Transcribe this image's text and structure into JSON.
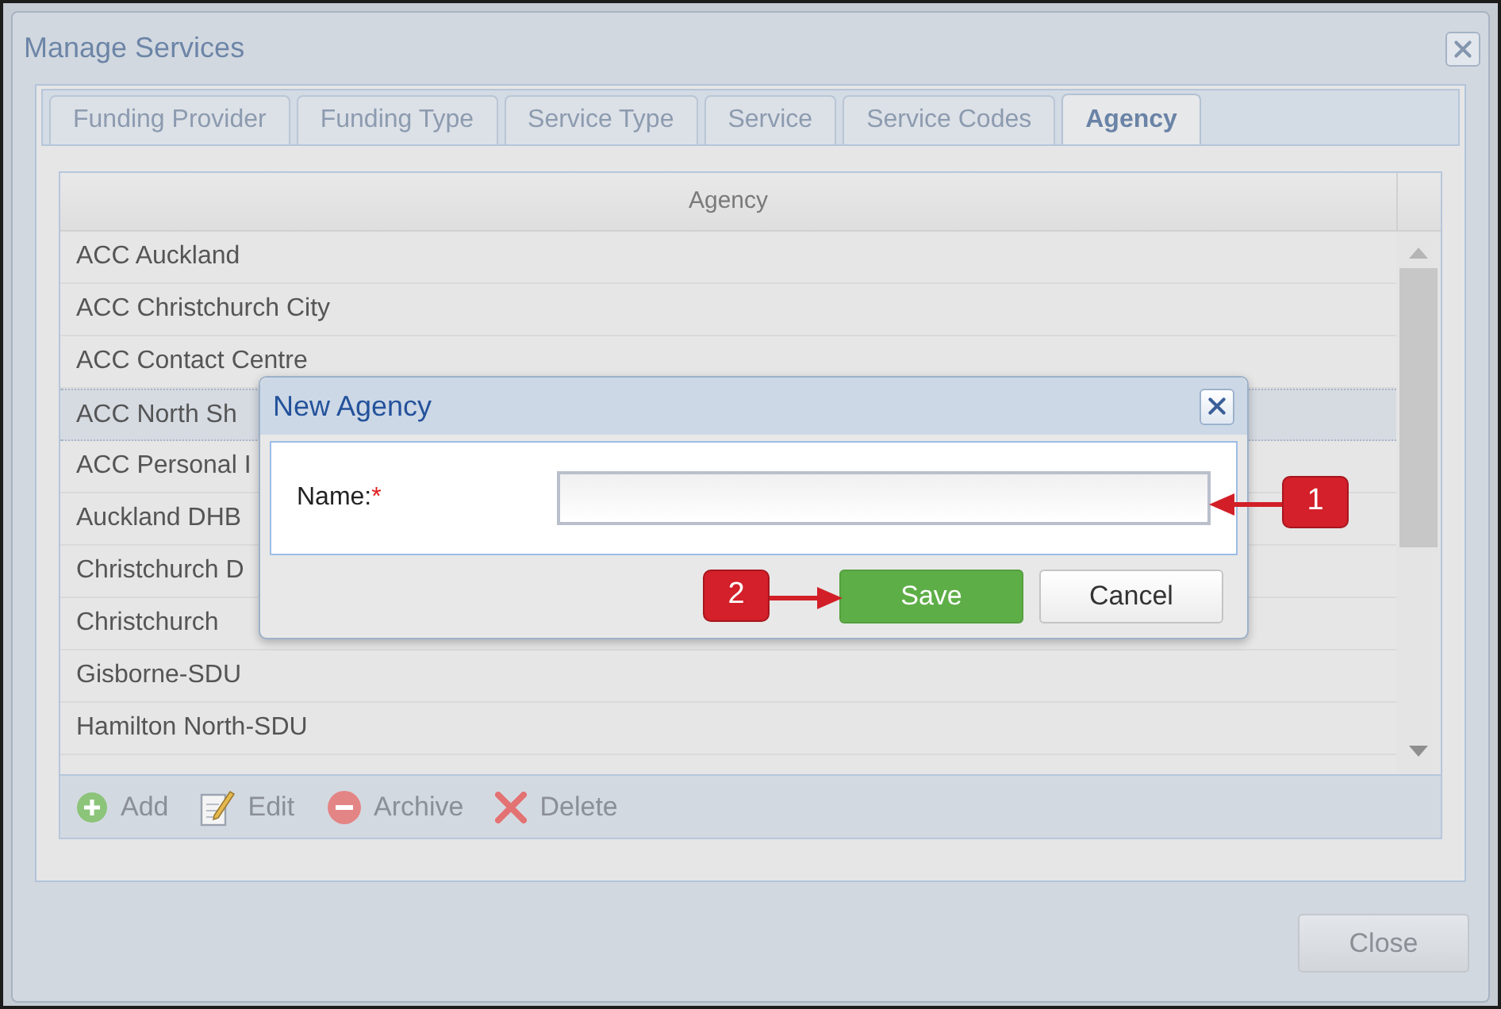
{
  "window": {
    "title": "Manage Services"
  },
  "tabs": [
    {
      "label": "Funding Provider",
      "selected": false
    },
    {
      "label": "Funding Type",
      "selected": false
    },
    {
      "label": "Service Type",
      "selected": false
    },
    {
      "label": "Service",
      "selected": false
    },
    {
      "label": "Service Codes",
      "selected": false
    },
    {
      "label": "Agency",
      "selected": true
    }
  ],
  "grid": {
    "column": "Agency",
    "rows": [
      {
        "name": "ACC Auckland",
        "selected": false
      },
      {
        "name": "ACC Christchurch City",
        "selected": false
      },
      {
        "name": "ACC Contact Centre",
        "selected": false
      },
      {
        "name": "ACC North Sh",
        "selected": true
      },
      {
        "name": "ACC Personal I",
        "selected": false
      },
      {
        "name": "Auckland DHB",
        "selected": false
      },
      {
        "name": "Christchurch D",
        "selected": false
      },
      {
        "name": "Christchurch",
        "selected": false
      },
      {
        "name": "Gisborne-SDU",
        "selected": false
      },
      {
        "name": "Hamilton North-SDU",
        "selected": false
      }
    ]
  },
  "toolbar": [
    {
      "kind": "add",
      "label": "Add"
    },
    {
      "kind": "edit",
      "label": "Edit"
    },
    {
      "kind": "archive",
      "label": "Archive"
    },
    {
      "kind": "delete",
      "label": "Delete"
    }
  ],
  "footer": {
    "buttons": [
      "Close"
    ]
  },
  "dialog": {
    "title": "New Agency",
    "field": {
      "label": "Name:",
      "required_mark": "*"
    },
    "buttons": [
      {
        "kind": "primary",
        "label": "Save"
      },
      {
        "kind": "secondary",
        "label": "Cancel"
      }
    ]
  },
  "callouts": [
    {
      "label": "1"
    },
    {
      "label": "2"
    }
  ]
}
